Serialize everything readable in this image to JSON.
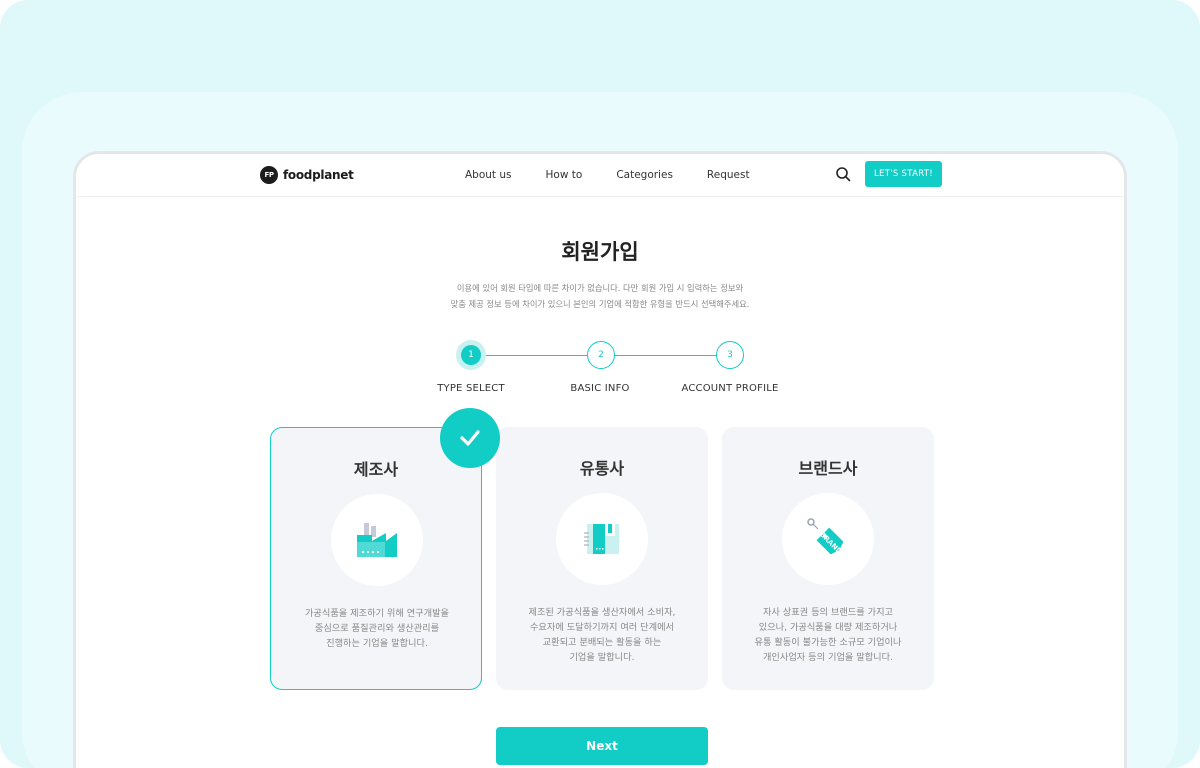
{
  "brand": {
    "logo_mark": "FP",
    "name": "foodplanet"
  },
  "nav": {
    "items": [
      "About us",
      "How to",
      "Categories",
      "Request"
    ],
    "search_icon": "search-icon",
    "cta_label": "LET'S START!"
  },
  "page": {
    "title": "회원가입",
    "description_line1": "이용에 있어 회원 타입에 따른 차이가 없습니다. 다만 회원 가입 시 입력하는 정보와",
    "description_line2": "맞춤 제공 정보 등에 차이가 있으니 본인의 기업에 적합한 유형을 반드시 선택해주세요."
  },
  "stepper": {
    "active_index": 0,
    "steps": [
      {
        "number": "1",
        "label": "TYPE SELECT"
      },
      {
        "number": "2",
        "label": "BASIC INFO"
      },
      {
        "number": "3",
        "label": "ACCOUNT PROFILE"
      }
    ]
  },
  "cards": [
    {
      "title": "제조사",
      "icon": "factory-icon",
      "selected": true,
      "description": [
        "가공식품을 제조하기 위해 연구개발을",
        "중심으로 품질관리와 생산관리를",
        "진행하는 기업을 말합니다."
      ]
    },
    {
      "title": "유통사",
      "icon": "box-icon",
      "selected": false,
      "description": [
        "제조된 가공식품을 생산자에서 소비자,",
        "수요자에 도달하기까지 여러 단계에서",
        "교환되고 분배되는 활동을 하는",
        "기업을 말합니다."
      ]
    },
    {
      "title": "브랜드사",
      "icon": "brand-tag-icon",
      "icon_text": "BRAND",
      "selected": false,
      "description": [
        "자사 상표권 등의 브랜드를 가지고",
        "있으나, 가공식품을 대량 제조하거나",
        "유통 활동이 불가능한 소규모 기업이나",
        "개인사업자 등의 기업을 말합니다."
      ]
    }
  ],
  "next_label": "Next",
  "colors": {
    "accent": "#12ccc6",
    "card_bg": "#f4f5f8",
    "backdrop": "#dff9fa"
  }
}
